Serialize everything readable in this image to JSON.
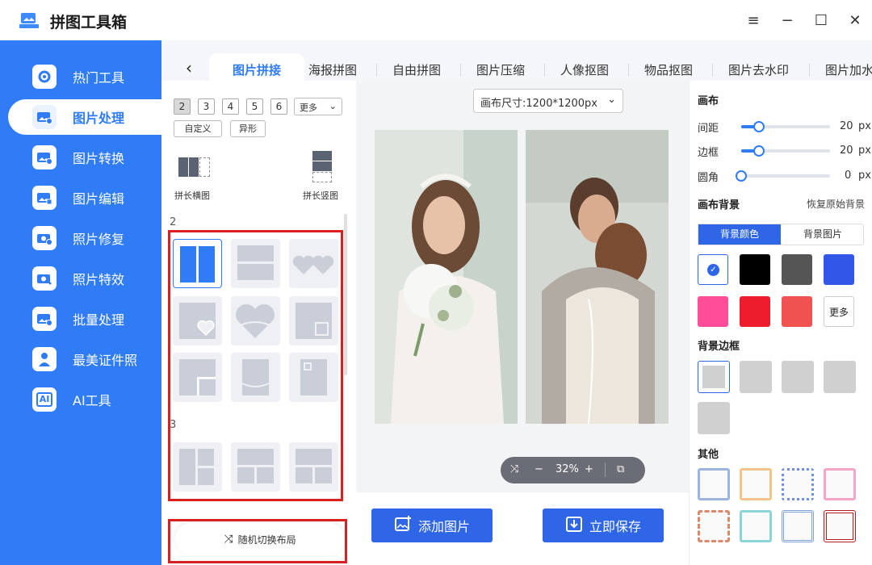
{
  "app": {
    "title": "拼图工具箱"
  },
  "window": {
    "menu_icon": "≡",
    "min_icon": "−",
    "max_icon": "☐",
    "close_icon": "✕"
  },
  "sidebar": {
    "items": [
      {
        "label": "热门工具",
        "icon": "gear-icon"
      },
      {
        "label": "图片处理",
        "icon": "image-icon"
      },
      {
        "label": "图片转换",
        "icon": "image-convert-icon"
      },
      {
        "label": "图片编辑",
        "icon": "image-edit-icon"
      },
      {
        "label": "照片修复",
        "icon": "camera-add-icon"
      },
      {
        "label": "照片特效",
        "icon": "camera-effect-icon"
      },
      {
        "label": "批量处理",
        "icon": "batch-icon"
      },
      {
        "label": "最美证件照",
        "icon": "id-photo-icon"
      },
      {
        "label": "AI工具",
        "icon": "ai-icon",
        "badge": "AI"
      }
    ],
    "active_index": 1
  },
  "tabs": [
    "图片拼接",
    "海报拼图",
    "自由拼图",
    "图片压缩",
    "人像抠图",
    "物品抠图",
    "图片去水印",
    "图片加水"
  ],
  "left_panel": {
    "counts": [
      "2",
      "3",
      "4",
      "5",
      "6"
    ],
    "more": "更多",
    "custom": "自定义",
    "special": "异形",
    "horizontal": "拼长横图",
    "vertical": "拼长竖图",
    "group2": "2",
    "group3": "3",
    "random": "随机切换布局"
  },
  "canvas": {
    "size_label": "画布尺寸:1200*1200px",
    "zoom": "32%"
  },
  "actions": {
    "add": "添加图片",
    "save": "立即保存"
  },
  "right_panel": {
    "canvas_title": "画布",
    "sliders": [
      {
        "label": "间距",
        "value": "20",
        "unit": "px",
        "level": 0.2
      },
      {
        "label": "边框",
        "value": "20",
        "unit": "px",
        "level": 0.2
      },
      {
        "label": "圆角",
        "value": "0",
        "unit": "px",
        "level": 0
      }
    ],
    "bg_title": "画布背景",
    "reset": "恢复原始背景",
    "bg_color_tab": "背景颜色",
    "bg_image_tab": "背景图片",
    "colors": [
      "#ffffff",
      "#000000",
      "#555555",
      "#3156e8",
      "#ff4d9a",
      "#ee1d2b",
      "#f05252"
    ],
    "more_colors": "更多",
    "frame_title": "背景边框",
    "other_title": "其他"
  }
}
